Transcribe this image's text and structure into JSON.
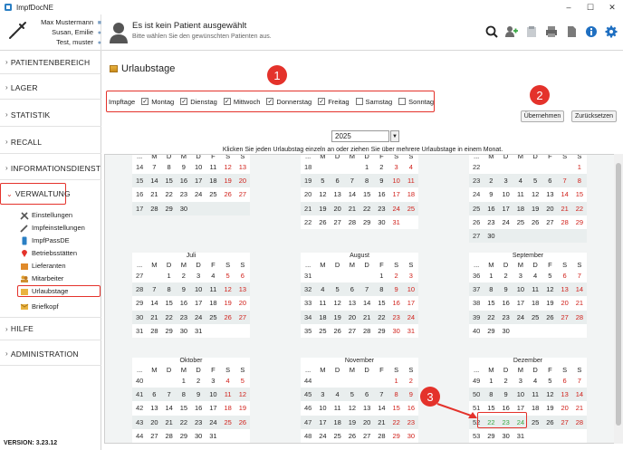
{
  "app": {
    "title": "ImpfDocNE"
  },
  "window": {
    "minimize": "–",
    "maximize": "☐",
    "close": "✕"
  },
  "user": {
    "lines": [
      "Max Mustermann",
      "Susan, Emilie",
      "Test, muster"
    ]
  },
  "patient": {
    "title": "Es ist kein Patient ausgewählt",
    "subtitle": "Bitte wählen Sie den gewünschten Patienten aus."
  },
  "toolbar": {
    "icons": [
      "search-icon",
      "add-person-icon",
      "clipboard-icon",
      "print-icon",
      "document-icon",
      "info-icon",
      "gear-icon"
    ]
  },
  "sidebar": {
    "sections": [
      "PATIENTENBEREICH",
      "LAGER",
      "STATISTIK",
      "RECALL",
      "INFORMATIONSDIENST",
      "VERWALTUNG",
      "HILFE",
      "ADMINISTRATION"
    ],
    "sub_items": [
      "Einstellungen",
      "Impfeinstellungen",
      "ImpfPassDE",
      "Betriebsstätten",
      "Lieferanten",
      "Mitarbeiter",
      "Urlaubstage",
      "Briefkopf"
    ],
    "version": "VERSION: 3.23.12"
  },
  "page": {
    "title": "Urlaubstage"
  },
  "impftage": {
    "label": "Impftage",
    "days": [
      {
        "label": "Montag",
        "checked": true
      },
      {
        "label": "Dienstag",
        "checked": true
      },
      {
        "label": "Mittwoch",
        "checked": true
      },
      {
        "label": "Donnerstag",
        "checked": true
      },
      {
        "label": "Freitag",
        "checked": true
      },
      {
        "label": "Samstag",
        "checked": false
      },
      {
        "label": "Sonntag",
        "checked": false
      }
    ]
  },
  "buttons": {
    "apply": "Übernehmen",
    "reset": "Zurücksetzen"
  },
  "year": {
    "value": "2025"
  },
  "instruction": "Klicken Sie jeden Urlaubstag einzeln an oder ziehen Sie über mehrere Urlaubstage in einem Monat.",
  "badges": [
    "1",
    "2",
    "3"
  ],
  "calendar": {
    "weekday_header": [
      "...",
      "M",
      "D",
      "M",
      "D",
      "F",
      "S",
      "S"
    ],
    "months": [
      {
        "name": "April",
        "rows": [
          [
            "14",
            "7",
            "8",
            "9",
            "10",
            "11",
            "12",
            "13"
          ],
          [
            "15",
            "14",
            "15",
            "16",
            "17",
            "18",
            "19",
            "20"
          ],
          [
            "16",
            "21",
            "22",
            "23",
            "24",
            "25",
            "26",
            "27"
          ],
          [
            "17",
            "28",
            "29",
            "30",
            "",
            "",
            "",
            ""
          ]
        ]
      },
      {
        "name": "Mai",
        "rows": [
          [
            "18",
            "",
            "",
            "",
            "1",
            "2",
            "3",
            "4"
          ],
          [
            "19",
            "5",
            "6",
            "7",
            "8",
            "9",
            "10",
            "11"
          ],
          [
            "20",
            "12",
            "13",
            "14",
            "15",
            "16",
            "17",
            "18"
          ],
          [
            "21",
            "19",
            "20",
            "21",
            "22",
            "23",
            "24",
            "25"
          ],
          [
            "22",
            "26",
            "27",
            "28",
            "29",
            "30",
            "31",
            ""
          ]
        ]
      },
      {
        "name": "Juni",
        "rows": [
          [
            "22",
            "",
            "",
            "",
            "",
            "",
            "",
            "1"
          ],
          [
            "23",
            "2",
            "3",
            "4",
            "5",
            "6",
            "7",
            "8"
          ],
          [
            "24",
            "9",
            "10",
            "11",
            "12",
            "13",
            "14",
            "15"
          ],
          [
            "25",
            "16",
            "17",
            "18",
            "19",
            "20",
            "21",
            "22"
          ],
          [
            "26",
            "23",
            "24",
            "25",
            "26",
            "27",
            "28",
            "29"
          ],
          [
            "27",
            "30",
            "",
            "",
            "",
            "",
            "",
            ""
          ]
        ]
      },
      {
        "name": "Juli",
        "rows": [
          [
            "27",
            "",
            "1",
            "2",
            "3",
            "4",
            "5",
            "6"
          ],
          [
            "28",
            "7",
            "8",
            "9",
            "10",
            "11",
            "12",
            "13"
          ],
          [
            "29",
            "14",
            "15",
            "16",
            "17",
            "18",
            "19",
            "20"
          ],
          [
            "30",
            "21",
            "22",
            "23",
            "24",
            "25",
            "26",
            "27"
          ],
          [
            "31",
            "28",
            "29",
            "30",
            "31",
            "",
            "",
            ""
          ]
        ]
      },
      {
        "name": "August",
        "rows": [
          [
            "31",
            "",
            "",
            "",
            "",
            "1",
            "2",
            "3"
          ],
          [
            "32",
            "4",
            "5",
            "6",
            "7",
            "8",
            "9",
            "10"
          ],
          [
            "33",
            "11",
            "12",
            "13",
            "14",
            "15",
            "16",
            "17"
          ],
          [
            "34",
            "18",
            "19",
            "20",
            "21",
            "22",
            "23",
            "24"
          ],
          [
            "35",
            "25",
            "26",
            "27",
            "28",
            "29",
            "30",
            "31"
          ]
        ]
      },
      {
        "name": "September",
        "rows": [
          [
            "36",
            "1",
            "2",
            "3",
            "4",
            "5",
            "6",
            "7"
          ],
          [
            "37",
            "8",
            "9",
            "10",
            "11",
            "12",
            "13",
            "14"
          ],
          [
            "38",
            "15",
            "16",
            "17",
            "18",
            "19",
            "20",
            "21"
          ],
          [
            "39",
            "22",
            "23",
            "24",
            "25",
            "26",
            "27",
            "28"
          ],
          [
            "40",
            "29",
            "30",
            "",
            "",
            "",
            "",
            ""
          ]
        ]
      },
      {
        "name": "Oktober",
        "rows": [
          [
            "40",
            "",
            "",
            "1",
            "2",
            "3",
            "4",
            "5"
          ],
          [
            "41",
            "6",
            "7",
            "8",
            "9",
            "10",
            "11",
            "12"
          ],
          [
            "42",
            "13",
            "14",
            "15",
            "16",
            "17",
            "18",
            "19"
          ],
          [
            "43",
            "20",
            "21",
            "22",
            "23",
            "24",
            "25",
            "26"
          ],
          [
            "44",
            "27",
            "28",
            "29",
            "30",
            "31",
            "",
            ""
          ]
        ]
      },
      {
        "name": "November",
        "rows": [
          [
            "44",
            "",
            "",
            "",
            "",
            "",
            "1",
            "2"
          ],
          [
            "45",
            "3",
            "4",
            "5",
            "6",
            "7",
            "8",
            "9"
          ],
          [
            "46",
            "10",
            "11",
            "12",
            "13",
            "14",
            "15",
            "16"
          ],
          [
            "47",
            "17",
            "18",
            "19",
            "20",
            "21",
            "22",
            "23"
          ],
          [
            "48",
            "24",
            "25",
            "26",
            "27",
            "28",
            "29",
            "30"
          ]
        ]
      },
      {
        "name": "Dezember",
        "rows": [
          [
            "49",
            "1",
            "2",
            "3",
            "4",
            "5",
            "6",
            "7"
          ],
          [
            "50",
            "8",
            "9",
            "10",
            "11",
            "12",
            "13",
            "14"
          ],
          [
            "51",
            "15",
            "16",
            "17",
            "18",
            "19",
            "20",
            "21"
          ],
          [
            "52",
            "22",
            "23",
            "24",
            "25",
            "26",
            "27",
            "28"
          ],
          [
            "53",
            "29",
            "30",
            "31",
            "",
            "",
            "",
            ""
          ]
        ]
      }
    ],
    "selected": {
      "month": "Dezember",
      "days": [
        "22",
        "23",
        "24"
      ]
    },
    "colors": {
      "weekend": "#d0201a",
      "selected": "#3aa845",
      "annotation": "#e4322b"
    }
  }
}
